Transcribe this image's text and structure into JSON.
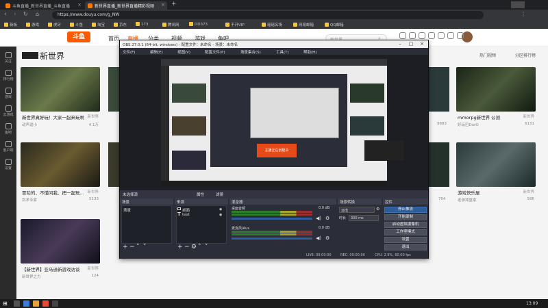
{
  "browser": {
    "tabs": [
      {
        "label": "斗鱼直播_新世界直播_斗鱼直播"
      },
      {
        "label": "新世界直播_新世界直播精彩视频"
      }
    ],
    "url": "https://www.douyu.com/g_NW",
    "bookmarks": [
      "新板",
      "游戏",
      "虎牙",
      "斗鱼",
      "淘宝",
      "京东",
      "173",
      "腾讯网",
      "DD373",
      "不开VIP",
      "瑶瑶名场",
      "网易邮箱",
      "QQ邮箱"
    ]
  },
  "site": {
    "logo": "斗鱼",
    "nav": [
      "首页",
      "直播",
      "分类",
      "视频",
      "游戏",
      "鱼吧"
    ],
    "active_nav": "直播",
    "search_placeholder": "新世界",
    "top_icons": [
      "登录",
      "下载",
      "关注",
      "历史",
      "消息",
      "客户端",
      "开播"
    ],
    "sidebar": [
      "关注",
      "排行榜",
      "游戏",
      "云游戏",
      "鱼吧",
      "客户端",
      "设置"
    ],
    "page_title": "新世界",
    "header_buttons": [
      "热门视频",
      "分区排行榜"
    ],
    "cards_left": [
      {
        "title": "新世界真好玩！大家一起来玩啊",
        "user": "动声逗小",
        "viewers": "4.1万",
        "category": "新世界"
      },
      {
        "title": "冒险的、不懂问我、把一起玩...",
        "user": "剑术专家",
        "viewers": "5133",
        "category": "新世界"
      },
      {
        "title": "【新世界】亚马逊新游戏访谈",
        "user": "新世界之力",
        "viewers": "124",
        "category": "新世界"
      }
    ],
    "cards_right": [
      {
        "title": "mmorpg新世界 公测",
        "user": "好玩巴DarO",
        "viewers": "6131",
        "category": "新世界"
      },
      {
        "title": "游戏快乐屋",
        "user": "老游戏皇家",
        "viewers": "586",
        "category": "新世界"
      }
    ],
    "cards_mid": [
      {
        "user": "",
        "viewers": "9883"
      },
      {
        "user": "",
        "viewers": "704"
      }
    ]
  },
  "obs": {
    "title": "OBS 27.0.1 (64-bit, windows) - 配置文件：未命名 - 场景：未命名",
    "menu": [
      "文件(F)",
      "编辑(E)",
      "视图(V)",
      "配置文件(P)",
      "场景集合(S)",
      "工具(T)",
      "帮助(H)"
    ],
    "source_bar": "未选择源",
    "source_bar_buttons": [
      "属性",
      "滤镜"
    ],
    "panels": {
      "scenes": {
        "title": "场景",
        "items": [
          "场景"
        ]
      },
      "sources": {
        "title": "来源",
        "items": [
          "桌面",
          "text"
        ]
      },
      "mixer": {
        "title": "混音器",
        "tracks": [
          {
            "name": "桌面音频",
            "db": "0.0 dB"
          },
          {
            "name": "麦克风/Aux",
            "db": "0.0 dB"
          }
        ]
      },
      "transitions": {
        "title": "场景转换",
        "type": "淡出",
        "duration_label": "时长",
        "duration": "300 ms"
      },
      "controls": {
        "title": "控件",
        "buttons": [
          "停止推流",
          "开始录制",
          "启动虚拟摄像机",
          "工作室模式",
          "设置",
          "退出"
        ]
      }
    },
    "status": {
      "live": "LIVE: 00:00:00",
      "rec": "REC: 00:00:00",
      "cpu": "CPU: 2.9%, 60.00 fps"
    },
    "inner_text": "主播正在创建中"
  },
  "taskbar": {
    "time": "13:09"
  },
  "colors": {
    "accent": "#ff5a00",
    "obs_bg": "#2b2e38"
  }
}
